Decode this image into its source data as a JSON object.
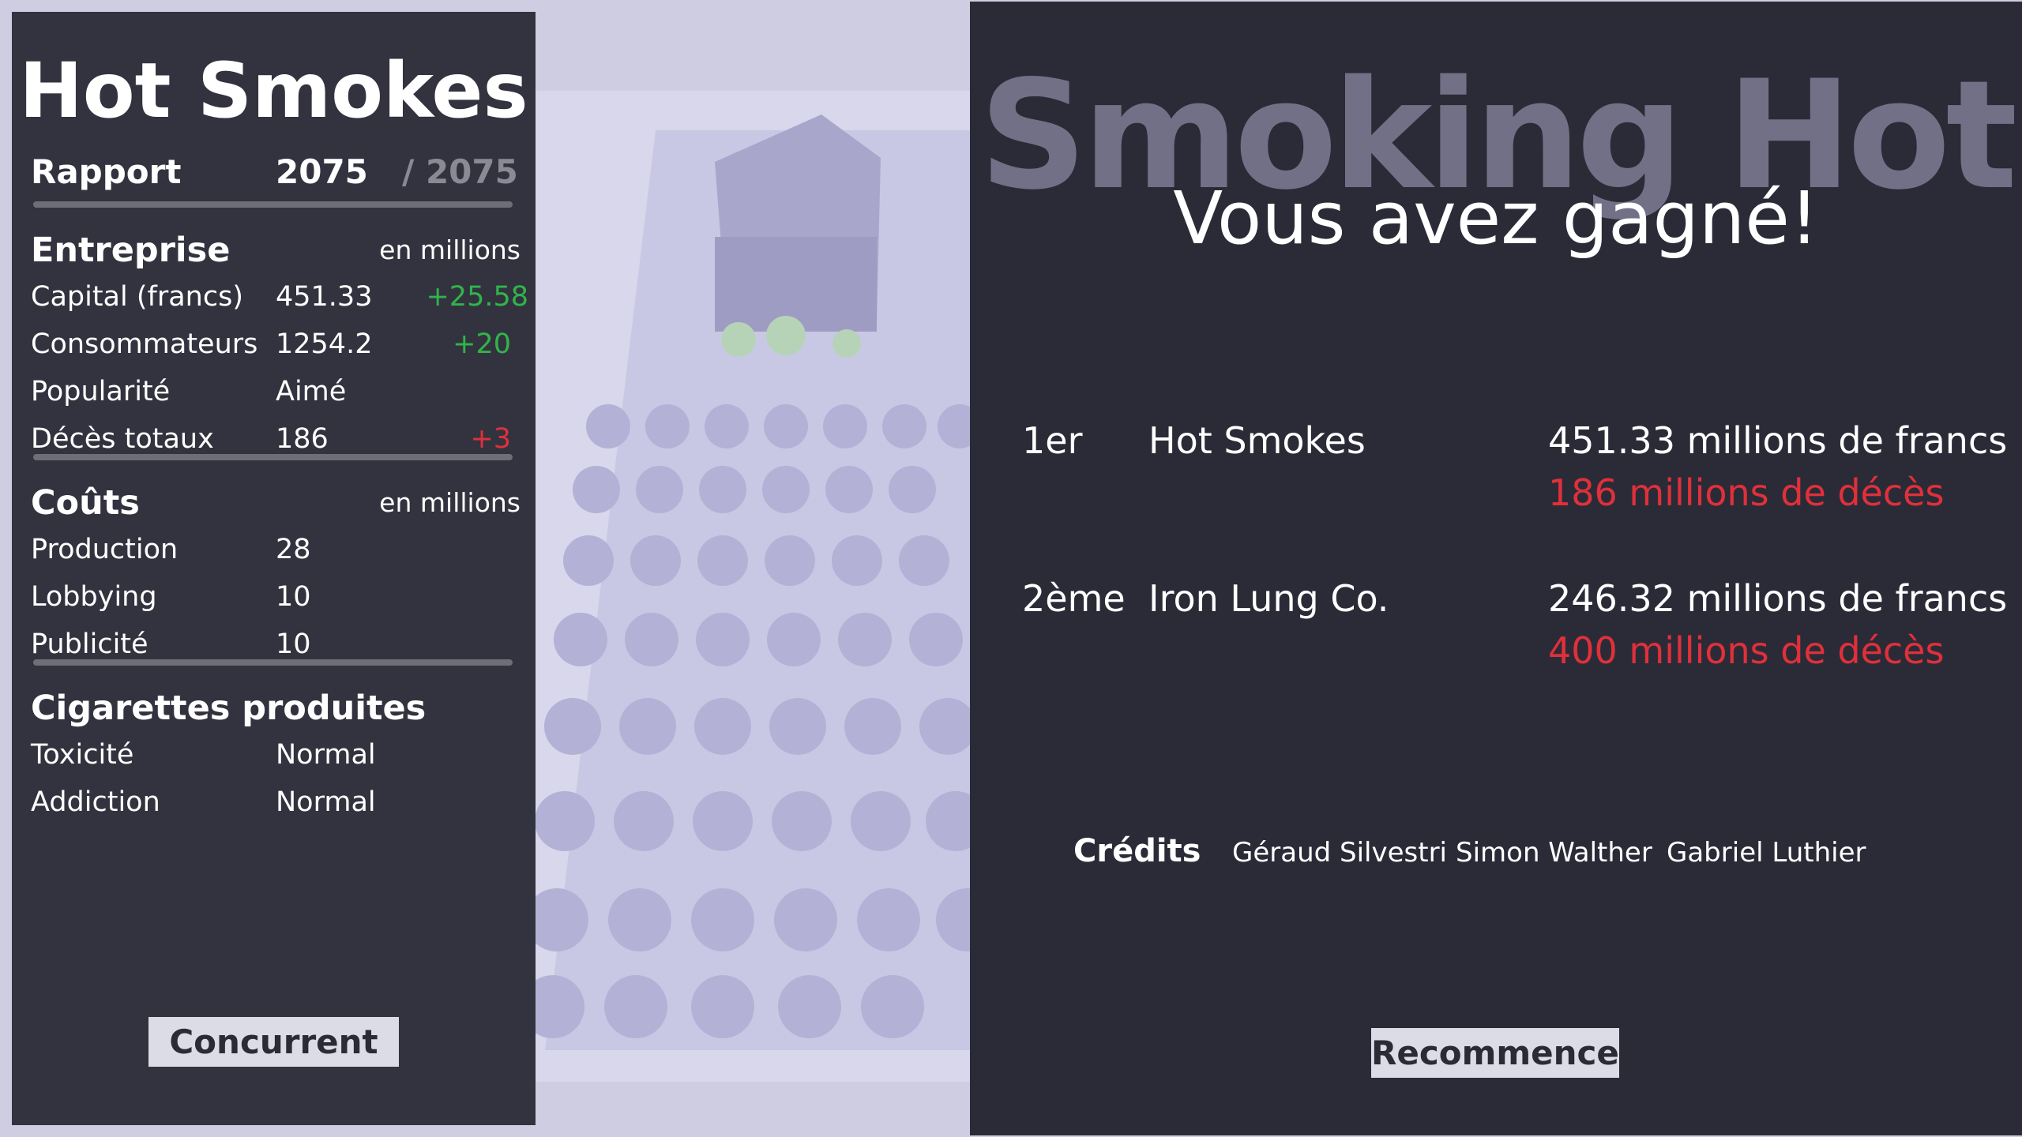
{
  "report": {
    "company": "Hot Smokes",
    "rapport_label": "Rapport",
    "year": "2075",
    "year_max": "/ 2075",
    "entreprise": {
      "title": "Entreprise",
      "unit": "en millions",
      "rows": [
        {
          "label": "Capital (francs)",
          "value": "451.33",
          "delta": "+25.58"
        },
        {
          "label": "Consommateurs",
          "value": "1254.2",
          "delta": "+20"
        },
        {
          "label": "Popularité",
          "value": "Aimé",
          "delta": ""
        },
        {
          "label": "Décès totaux",
          "value": "186",
          "delta": "+3"
        }
      ]
    },
    "couts": {
      "title": "Coûts",
      "unit": "en millions",
      "rows": [
        {
          "label": "Production",
          "value": "28"
        },
        {
          "label": "Lobbying",
          "value": "10"
        },
        {
          "label": "Publicité",
          "value": "10"
        }
      ]
    },
    "cigarettes": {
      "title": "Cigarettes produites",
      "rows": [
        {
          "label": "Toxicité",
          "value": "Normal"
        },
        {
          "label": "Addiction",
          "value": "Normal"
        }
      ]
    },
    "concurrent_button": "Concurrent"
  },
  "result": {
    "logo": "Smoking Hot",
    "message": "Vous avez gagné!",
    "rankings": [
      {
        "rank": "1er",
        "name": "Hot Smokes",
        "money": "451.33 millions de francs",
        "deaths": "186 millions de décès"
      },
      {
        "rank": "2ème",
        "name": "Iron Lung Co.",
        "money": "246.32 millions de francs",
        "deaths": "400 millions de décès"
      }
    ],
    "credits_title": "Crédits",
    "credits": [
      "Géraud Silvestri",
      "Simon Walther",
      "Gabriel Luthier"
    ],
    "restart_button": "Recommencer"
  },
  "colors": {
    "panel": "#33333f",
    "result_panel": "#2b2b38",
    "positive": "#2fb54a",
    "negative": "#e0303a",
    "background": "#cfcde2"
  }
}
